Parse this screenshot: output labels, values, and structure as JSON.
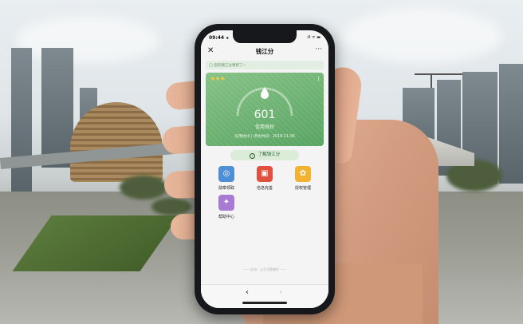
{
  "status_bar": {
    "time": "09:44 ◂",
    "icons": "ıll ᯤ ▬"
  },
  "navbar": {
    "close_glyph": "✕",
    "title": "钱江分",
    "more_glyph": "···"
  },
  "notice": {
    "glyph": "◯",
    "text": "您的钱江分更新了~"
  },
  "score_card": {
    "medals": "◉◉◉",
    "share_glyph": "⟨",
    "score": "601",
    "level": "信用良好",
    "eval_label": "信用杭州 | 评估时间：",
    "eval_date": "2018-11-06"
  },
  "learn_button": {
    "icon": "i",
    "label": "了解钱江分"
  },
  "features": [
    {
      "label": "勋章领取",
      "icon": "medal-icon",
      "color": "#4e8fd6",
      "glyph": "◎"
    },
    {
      "label": "信息完善",
      "icon": "document-icon",
      "color": "#e0503f",
      "glyph": "▣"
    },
    {
      "label": "授权管理",
      "icon": "authorize-icon",
      "color": "#f3b332",
      "glyph": "✿"
    },
    {
      "label": "帮助中心",
      "icon": "help-icon",
      "color": "#a77bd4",
      "glyph": "✦"
    }
  ],
  "footer_note": "—— 杭州，让生活更美好 ——",
  "bottom_nav": {
    "back_glyph": "‹",
    "forward_glyph": "›"
  }
}
